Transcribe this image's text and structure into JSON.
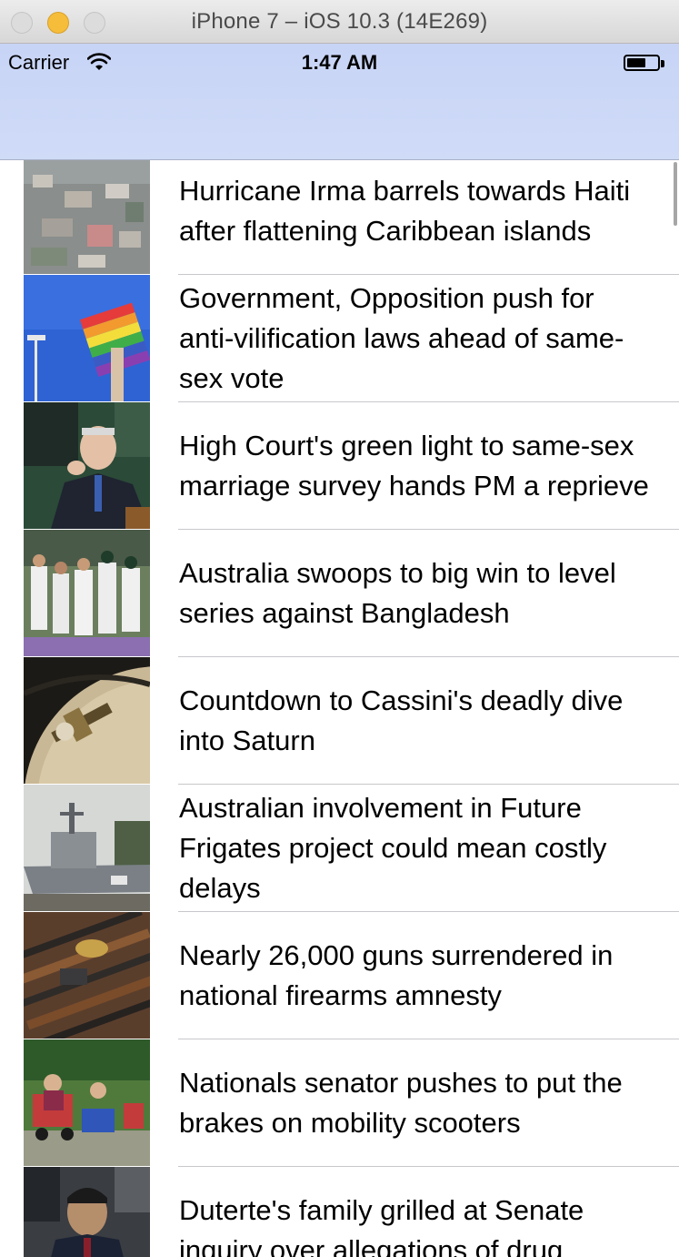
{
  "window": {
    "title": "iPhone 7 – iOS 10.3 (14E269)"
  },
  "status_bar": {
    "carrier": "Carrier",
    "time": "1:47 AM"
  },
  "articles": [
    {
      "headline": "Hurricane Irma barrels towards Haiti after flattening Caribbean islands"
    },
    {
      "headline": "Government, Opposition push for anti-vilification laws ahead of same-sex vote"
    },
    {
      "headline": "High Court's green light to same-sex marriage survey hands PM a reprieve"
    },
    {
      "headline": "Australia swoops to big win to level series against Bangladesh"
    },
    {
      "headline": "Countdown to Cassini's deadly dive into Saturn"
    },
    {
      "headline": "Australian involvement in Future Frigates project could mean costly delays"
    },
    {
      "headline": "Nearly 26,000 guns surrendered in national firearms amnesty"
    },
    {
      "headline": "Nationals senator pushes to put the brakes on mobility scooters"
    },
    {
      "headline": "Duterte's family grilled at Senate inquiry over allegations of drug"
    }
  ]
}
